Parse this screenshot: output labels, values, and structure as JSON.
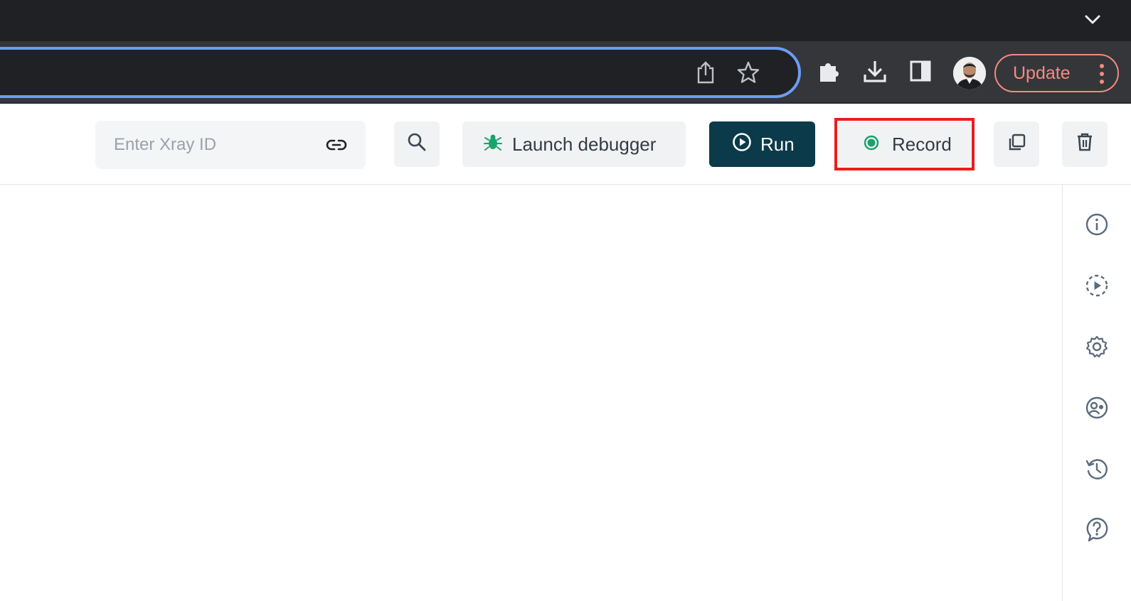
{
  "browser": {
    "update_label": "Update",
    "colors": {
      "tabstrip": "#202124",
      "toolbar": "#35363a",
      "omnibox_focus": "#6b9df5",
      "update_accent": "#f28b82"
    }
  },
  "toolbar": {
    "xray": {
      "placeholder": "Enter Xray ID",
      "value": ""
    },
    "launch_debugger_label": "Launch debugger",
    "run_label": "Run",
    "record_label": "Record",
    "colors": {
      "run_bg": "#0b3a4a",
      "record_dot": "#1aa36c",
      "debugger_icon": "#1aa36c",
      "highlight": "#ee1c1c"
    }
  },
  "right_rail": {
    "icons": [
      "info-icon",
      "replay-icon",
      "settings-icon",
      "user-icon",
      "history-icon",
      "help-icon"
    ]
  }
}
